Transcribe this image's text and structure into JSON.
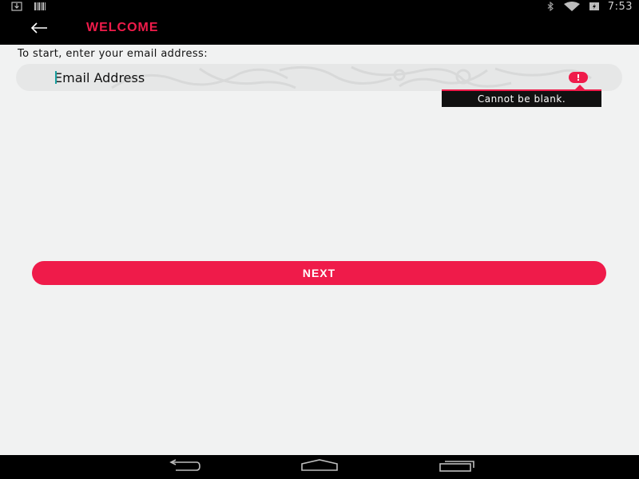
{
  "status_bar": {
    "time": "7:53",
    "left_icons": [
      "download-icon",
      "barcode-icon"
    ],
    "right_icons": [
      "bluetooth-icon",
      "wifi-icon",
      "battery-charging-icon"
    ]
  },
  "app_bar": {
    "title": "WELCOME",
    "back_icon": "arrow-left-icon"
  },
  "form": {
    "prompt": "To start, enter your email address:",
    "email": {
      "value": "",
      "placeholder": "Email Address",
      "error_icon": "exclamation-icon",
      "error_message": "Cannot be blank."
    },
    "next_label": "NEXT"
  },
  "nav_bar": {
    "icons": [
      "back-icon",
      "home-icon",
      "recents-icon"
    ]
  },
  "colors": {
    "accent": "#ef1b4a",
    "bar_background": "#000000",
    "page_background": "#f1f2f2",
    "field_background": "#e6e7e7",
    "caret": "#19a0a0"
  }
}
